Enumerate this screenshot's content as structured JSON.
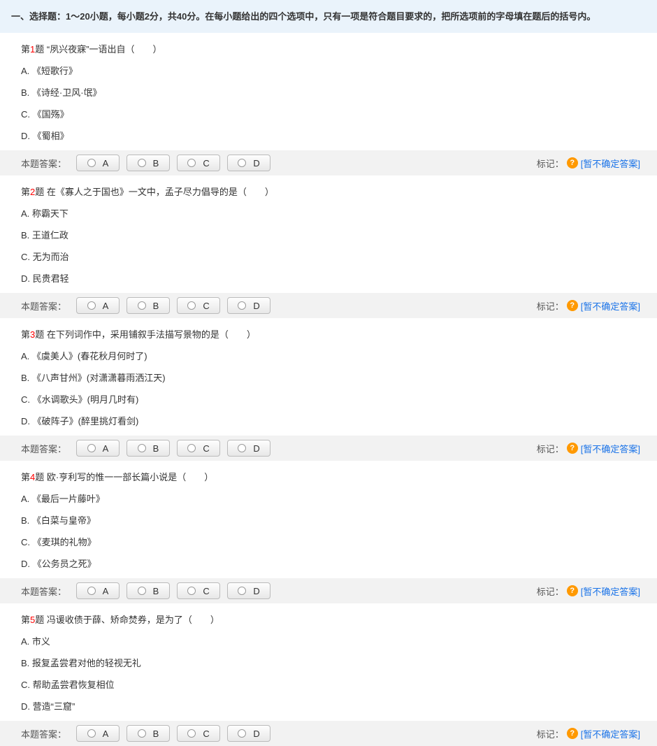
{
  "section_header": "一、选择题：1～20小题，每小题2分，共40分。在每小题给出的四个选项中，只有一项是符合题目要求的，把所选项前的字母填在题后的括号内。",
  "answer_label": "本题答案：",
  "mark_label": "标记：",
  "uncertain_label": "[暂不确定答案]",
  "choices": {
    "A": "A",
    "B": "B",
    "C": "C",
    "D": "D"
  },
  "questions": [
    {
      "prefix": "第",
      "num": "1",
      "suffix": "题",
      "stem": "“夙兴夜寐”一语出自（　　）",
      "options": {
        "A": "A. 《短歌行》",
        "B": "B. 《诗经·卫风·氓》",
        "C": "C. 《国殇》",
        "D": "D. 《蜀相》"
      }
    },
    {
      "prefix": "第",
      "num": "2",
      "suffix": "题",
      "stem": "在《寡人之于国也》一文中，孟子尽力倡导的是（　　）",
      "options": {
        "A": "A. 称霸天下",
        "B": "B. 王道仁政",
        "C": "C. 无为而治",
        "D": "D. 民贵君轻"
      }
    },
    {
      "prefix": "第",
      "num": "3",
      "suffix": "题",
      "stem": "在下列词作中，采用铺叙手法描写景物的是（　　）",
      "options": {
        "A": "A. 《虞美人》(春花秋月何时了)",
        "B": "B. 《八声甘州》(对潇潇暮雨洒江天)",
        "C": "C. 《水调歌头》(明月几时有)",
        "D": "D. 《破阵子》(醉里挑灯看剑)"
      }
    },
    {
      "prefix": "第",
      "num": "4",
      "suffix": "题",
      "stem": "欧·亨利写的惟一一部长篇小说是（　　）",
      "options": {
        "A": "A. 《最后一片藤叶》",
        "B": "B. 《白菜与皇帝》",
        "C": "C. 《麦琪的礼物》",
        "D": "D. 《公务员之死》"
      }
    },
    {
      "prefix": "第",
      "num": "5",
      "suffix": "题",
      "stem": "冯谖收债于薛、矫命焚券，是为了（　　）",
      "options": {
        "A": "A. 市义",
        "B": "B. 报复孟尝君对他的轻视无礼",
        "C": "C. 帮助孟尝君恢复相位",
        "D": "D. 营造“三窟”"
      }
    }
  ]
}
